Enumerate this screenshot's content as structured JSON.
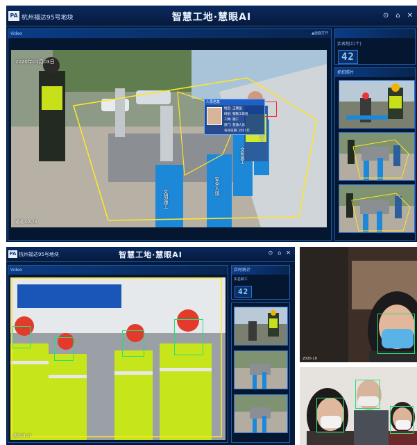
{
  "top": {
    "logo": "PA",
    "site": "杭州福达95号地块",
    "title": "智慧工地·慧眼AI",
    "controls": [
      "⊙",
      "⌂",
      "✕"
    ],
    "video_label": "Video",
    "video_right": "▲画面打开",
    "timestamp": "2020年01月03日",
    "channel": "通道:02-73",
    "card": {
      "head": "人员信息",
      "fields": [
        "姓名: 王建国",
        "班组: 钢筋工班组",
        "工种: 钢工",
        "部门: 普通人员",
        "有效日期: 2021年"
      ]
    },
    "counter_label": "实名制工(个)",
    "counter": "42",
    "snapshot_label": "抓拍照片",
    "signs": [
      "文明施工",
      "安全入场",
      "文明施工",
      "安全"
    ]
  },
  "bottom": {
    "logo": "PA",
    "site": "杭州福达95号地块",
    "title": "智慧工地·慧眼AI",
    "controls": [
      "⊙",
      "⌂",
      "✕"
    ],
    "video_label": "Video",
    "side_label": "实时统计",
    "counter_label": "实名制工",
    "counter": "42",
    "channel": "通道:01-17"
  },
  "photo_top": {
    "caption": "2020-10"
  },
  "colors": {
    "hud_bg": "#061a3a",
    "accent": "#1c5fb0",
    "detect_box": "#25e07a",
    "alert_box": "#ff2a2a",
    "zone": "#ffe52a"
  }
}
